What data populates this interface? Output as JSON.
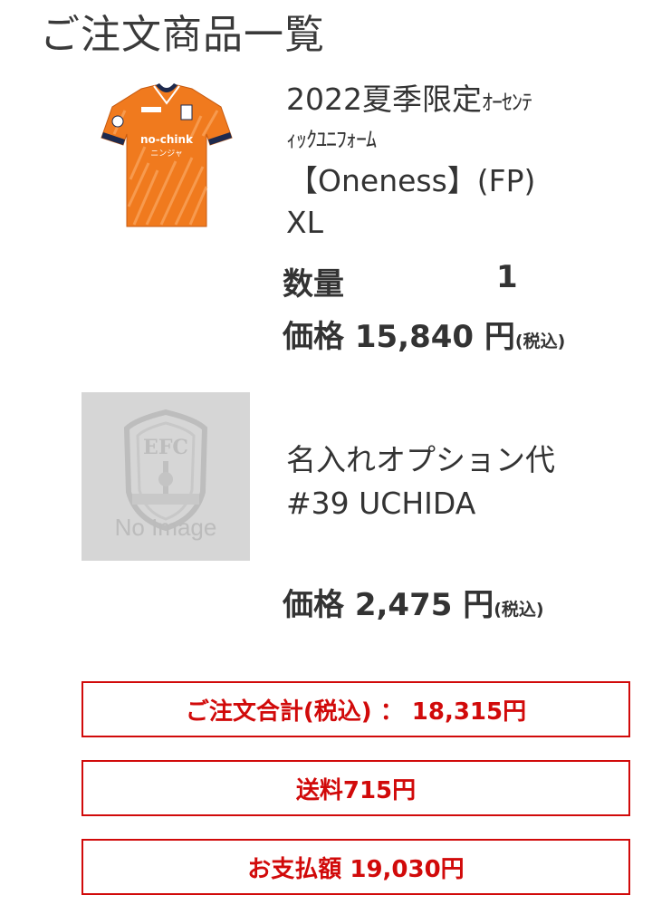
{
  "page": {
    "title": "ご注文商品一覧"
  },
  "items": [
    {
      "name_line1_main": "2022夏季限定",
      "name_line1_small": "ｵｰｾﾝﾃ",
      "name_line2_small": "ｨｯｸﾕﾆﾌｫｰﾑ",
      "name_line3": "【Oneness】(FP)",
      "name_line4": "XL",
      "quantity_label": "数量",
      "quantity_value": "1",
      "price_label": "価格",
      "price_value": "15,840 円",
      "tax_note": "(税込)",
      "image": {
        "type": "jersey",
        "shirt_color": "#f07a1e",
        "collar_color": "#1d2a4e",
        "sponsor_text": "no-chink",
        "sponsor_sub": "ニンジャ"
      }
    },
    {
      "name_line1": "名入れオプション代",
      "name_line2": "#39 UCHIDA",
      "price_label": "価格",
      "price_value": "2,475 円",
      "tax_note": "(税込)",
      "image": {
        "type": "placeholder",
        "label": "No Image",
        "emblem_text": "EFC"
      }
    }
  ],
  "summary": {
    "total": "ご注文合計(税込) ： 18,315円",
    "shipping": "送料715円",
    "payment": "お支払額 19,030円"
  },
  "colors": {
    "accent_red": "#d10a0a",
    "text_dark": "#333333",
    "placeholder_bg": "#d6d6d6"
  }
}
